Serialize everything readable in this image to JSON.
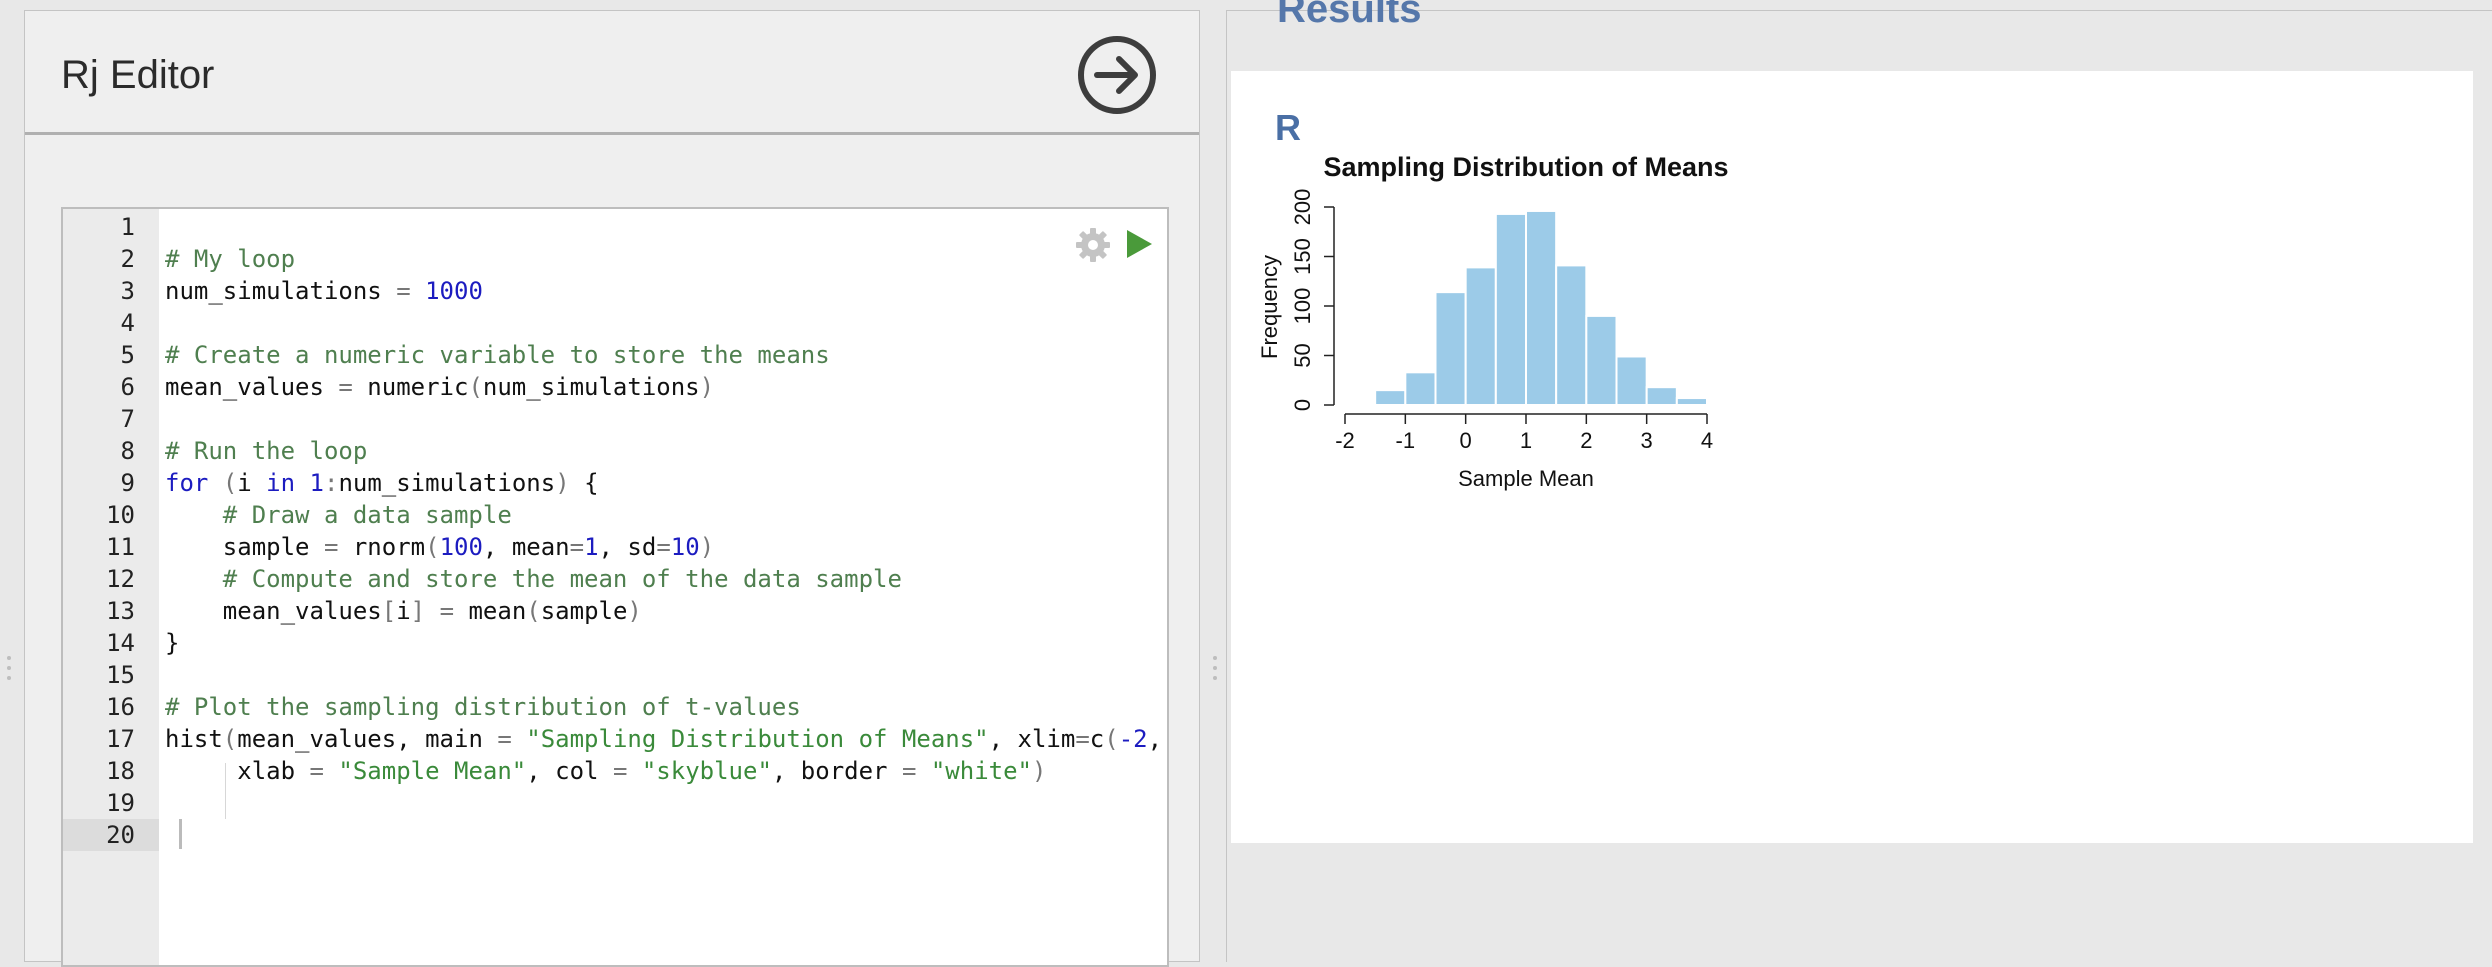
{
  "editor": {
    "title": "Rj Editor",
    "lines": [
      [],
      [
        {
          "t": "# My loop",
          "c": "c"
        }
      ],
      [
        {
          "t": "num_simulations ",
          "c": ""
        },
        {
          "t": "=",
          "c": "p"
        },
        {
          "t": " ",
          "c": ""
        },
        {
          "t": "1000",
          "c": "n"
        }
      ],
      [],
      [
        {
          "t": "# Create a numeric variable to store the means",
          "c": "c"
        }
      ],
      [
        {
          "t": "mean_values ",
          "c": ""
        },
        {
          "t": "=",
          "c": "p"
        },
        {
          "t": " numeric",
          "c": ""
        },
        {
          "t": "(",
          "c": "p"
        },
        {
          "t": "num_simulations",
          "c": ""
        },
        {
          "t": ")",
          "c": "p"
        }
      ],
      [],
      [
        {
          "t": "# Run the loop",
          "c": "c"
        }
      ],
      [
        {
          "t": "for",
          "c": "k"
        },
        {
          "t": " ",
          "c": ""
        },
        {
          "t": "(",
          "c": "p"
        },
        {
          "t": "i ",
          "c": ""
        },
        {
          "t": "in",
          "c": "k"
        },
        {
          "t": " ",
          "c": ""
        },
        {
          "t": "1",
          "c": "n"
        },
        {
          "t": ":",
          "c": "p"
        },
        {
          "t": "num_simulations",
          "c": ""
        },
        {
          "t": ")",
          "c": "p"
        },
        {
          "t": " {",
          "c": ""
        }
      ],
      [
        {
          "t": "    ",
          "c": ""
        },
        {
          "t": "# Draw a data sample",
          "c": "c"
        }
      ],
      [
        {
          "t": "    sample ",
          "c": ""
        },
        {
          "t": "=",
          "c": "p"
        },
        {
          "t": " rnorm",
          "c": ""
        },
        {
          "t": "(",
          "c": "p"
        },
        {
          "t": "100",
          "c": "n"
        },
        {
          "t": ", mean",
          "c": ""
        },
        {
          "t": "=",
          "c": "p"
        },
        {
          "t": "1",
          "c": "n"
        },
        {
          "t": ", sd",
          "c": ""
        },
        {
          "t": "=",
          "c": "p"
        },
        {
          "t": "10",
          "c": "n"
        },
        {
          "t": ")",
          "c": "p"
        }
      ],
      [
        {
          "t": "    ",
          "c": ""
        },
        {
          "t": "# Compute and store the mean of the data sample",
          "c": "c"
        }
      ],
      [
        {
          "t": "    mean_values",
          "c": ""
        },
        {
          "t": "[",
          "c": "p"
        },
        {
          "t": "i",
          "c": ""
        },
        {
          "t": "]",
          "c": "p"
        },
        {
          "t": " ",
          "c": ""
        },
        {
          "t": "=",
          "c": "p"
        },
        {
          "t": " mean",
          "c": ""
        },
        {
          "t": "(",
          "c": "p"
        },
        {
          "t": "sample",
          "c": ""
        },
        {
          "t": ")",
          "c": "p"
        }
      ],
      [
        {
          "t": "}",
          "c": ""
        }
      ],
      [],
      [
        {
          "t": "# Plot the sampling distribution of t-values",
          "c": "c"
        }
      ],
      [
        {
          "t": "hist",
          "c": ""
        },
        {
          "t": "(",
          "c": "p"
        },
        {
          "t": "mean_values, main ",
          "c": ""
        },
        {
          "t": "=",
          "c": "p"
        },
        {
          "t": " ",
          "c": ""
        },
        {
          "t": "\"Sampling Distribution of Means\"",
          "c": "s"
        },
        {
          "t": ", xlim",
          "c": ""
        },
        {
          "t": "=",
          "c": "p"
        },
        {
          "t": "c",
          "c": ""
        },
        {
          "t": "(",
          "c": "p"
        },
        {
          "t": "-2",
          "c": "n"
        },
        {
          "t": ",",
          "c": ""
        }
      ],
      [
        {
          "t": "     xlab ",
          "c": ""
        },
        {
          "t": "=",
          "c": "p"
        },
        {
          "t": " ",
          "c": ""
        },
        {
          "t": "\"Sample Mean\"",
          "c": "s"
        },
        {
          "t": ", col ",
          "c": ""
        },
        {
          "t": "=",
          "c": "p"
        },
        {
          "t": " ",
          "c": ""
        },
        {
          "t": "\"skyblue\"",
          "c": "s"
        },
        {
          "t": ", border ",
          "c": ""
        },
        {
          "t": "=",
          "c": "p"
        },
        {
          "t": " ",
          "c": ""
        },
        {
          "t": "\"white\"",
          "c": "s"
        },
        {
          "t": ")",
          "c": "p"
        }
      ],
      [],
      []
    ],
    "active_line": 20
  },
  "results": {
    "title": "Results",
    "label": "R"
  },
  "chart_data": {
    "type": "bar",
    "title": "Sampling Distribution of Means",
    "xlabel": "Sample Mean",
    "ylabel": "Frequency",
    "bin_edges": [
      -2.5,
      -2,
      -1.5,
      -1,
      -0.5,
      0,
      0.5,
      1,
      1.5,
      2,
      2.5,
      3,
      3.5,
      4
    ],
    "values": [
      1,
      2,
      15,
      33,
      114,
      139,
      193,
      196,
      141,
      90,
      49,
      18,
      7
    ],
    "xlim": [
      -2,
      4
    ],
    "ylim": [
      0,
      200
    ],
    "x_ticks": [
      "-2",
      "-1",
      "0",
      "1",
      "2",
      "3",
      "4"
    ],
    "y_ticks": [
      "0",
      "50",
      "100",
      "150",
      "200"
    ],
    "bar_color": "#9ccbe8",
    "border_color": "#ffffff"
  }
}
